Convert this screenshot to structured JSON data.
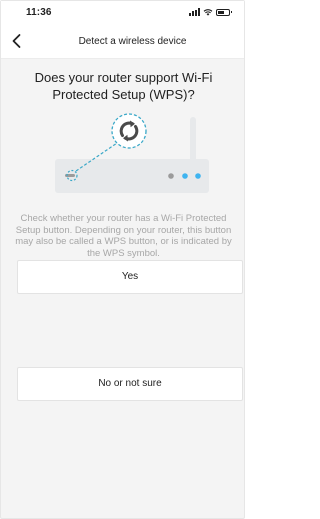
{
  "status_bar": {
    "time": "11:36",
    "icons": [
      "signal-icon",
      "wifi-icon",
      "battery-icon"
    ]
  },
  "nav": {
    "back_icon": "chevron-left-icon",
    "title": "Detect a wireless device"
  },
  "question": "Does your router support Wi-Fi Protected Setup (WPS)?",
  "illustration": {
    "device": "router-icon",
    "symbol": "wps-icon",
    "indicator_colors": [
      "#9b9b9b",
      "#3fb4f0",
      "#3fb4f0"
    ],
    "accent_color": "#3aa8c8"
  },
  "description": "Check whether your router has a Wi-Fi Protected Setup button. Depending on your router, this button may also be called a WPS button, or is indicated by the WPS symbol.",
  "options": {
    "yes_label": "Yes",
    "no_label": "No or not sure"
  }
}
